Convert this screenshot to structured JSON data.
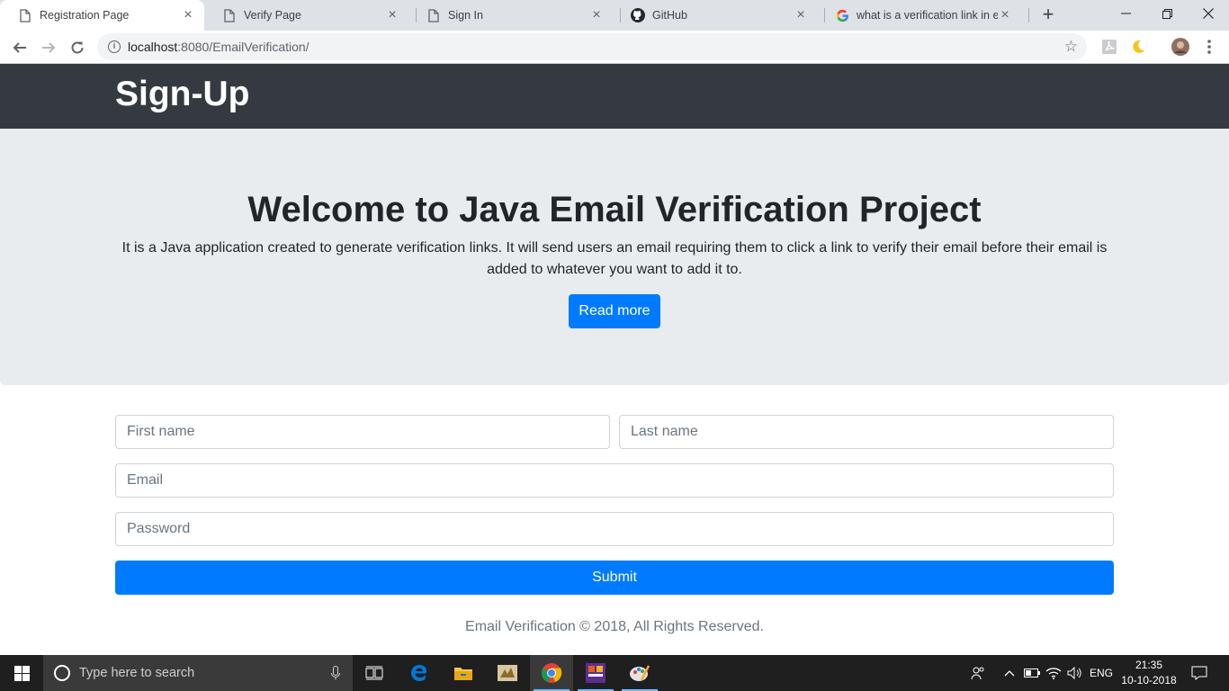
{
  "browser": {
    "tabs": [
      {
        "label": "Registration Page",
        "icon": "page-icon",
        "active": true
      },
      {
        "label": "Verify Page",
        "icon": "page-icon",
        "active": false
      },
      {
        "label": "Sign In",
        "icon": "page-icon",
        "active": false
      },
      {
        "label": "GitHub",
        "icon": "github-icon",
        "active": false
      },
      {
        "label": "what is a verification link in em",
        "icon": "google-icon",
        "active": false
      }
    ],
    "url_host": "localhost",
    "url_rest": ":8080/EmailVerification/"
  },
  "site": {
    "brand": "Sign-Up",
    "hero_title": "Welcome to Java Email Verification Project",
    "hero_text": "It is a Java application created to generate verification links. It will send users an email requiring them to click a link to verify their email before their email is added to whatever you want to add it to.",
    "read_more": "Read more",
    "form": {
      "first_name_placeholder": "First name",
      "last_name_placeholder": "Last name",
      "email_placeholder": "Email",
      "password_placeholder": "Password",
      "submit": "Submit"
    },
    "footer": "Email Verification © 2018, All Rights Reserved."
  },
  "taskbar": {
    "search_placeholder": "Type here to search",
    "language": "ENG",
    "time": "21:35",
    "date": "10-10-2018"
  },
  "colors": {
    "navbar": "#343a40",
    "jumbotron": "#e9ecef",
    "primary": "#007bff"
  }
}
